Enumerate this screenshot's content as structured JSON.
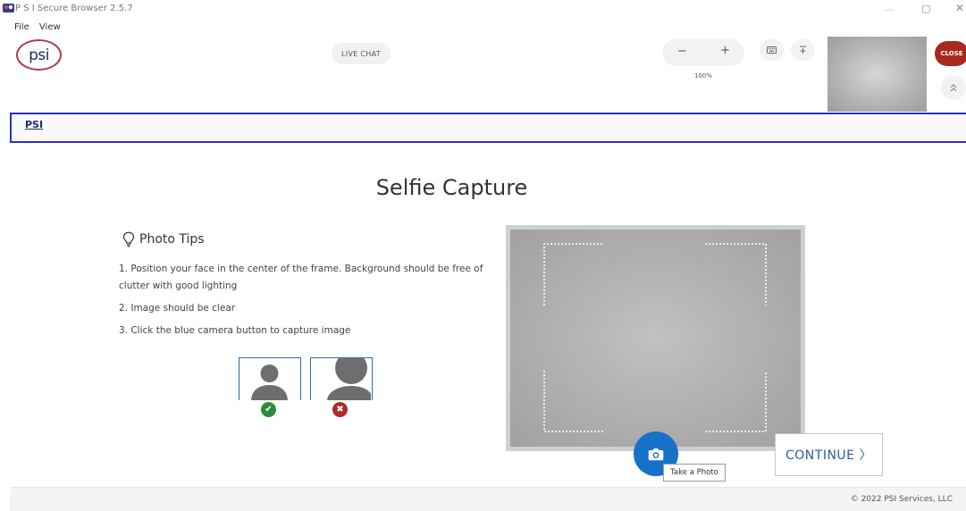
{
  "window": {
    "title": "P S I Secure Browser 2.5.7",
    "minimize_glyph": "—",
    "maximize_glyph": "▢",
    "close_glyph": "✕"
  },
  "menu": [
    "File",
    "View"
  ],
  "header": {
    "logo_text": "psi",
    "live_chat_label": "LIVE CHAT",
    "zoom_minus": "−",
    "zoom_plus": "+",
    "zoom_level": "100%",
    "keyboard_icon": "keyboard-icon",
    "calculator_icon": "calculator-icon",
    "close_label": "CLOSE",
    "collapse_glyph": "«",
    "brand_color": "#a8291e"
  },
  "nav": {
    "tab_label": "PSI",
    "border_color": "#2b2fbf"
  },
  "main": {
    "title": "Selfie Capture",
    "tips_heading": "Photo Tips",
    "tips": [
      "1. Position your face in the center of the frame. Background should be free of clutter with good lighting",
      "2. Image should be clear",
      "3. Click the blue camera button to capture image"
    ],
    "good_mark": "✔",
    "bad_mark": "✖"
  },
  "camera": {
    "take_photo_tooltip": "Take a Photo",
    "button_color": "#1771c8"
  },
  "actions": {
    "continue_label": "CONTINUE 〉"
  },
  "footer": {
    "copyright": "© 2022 PSI Services, LLC"
  }
}
